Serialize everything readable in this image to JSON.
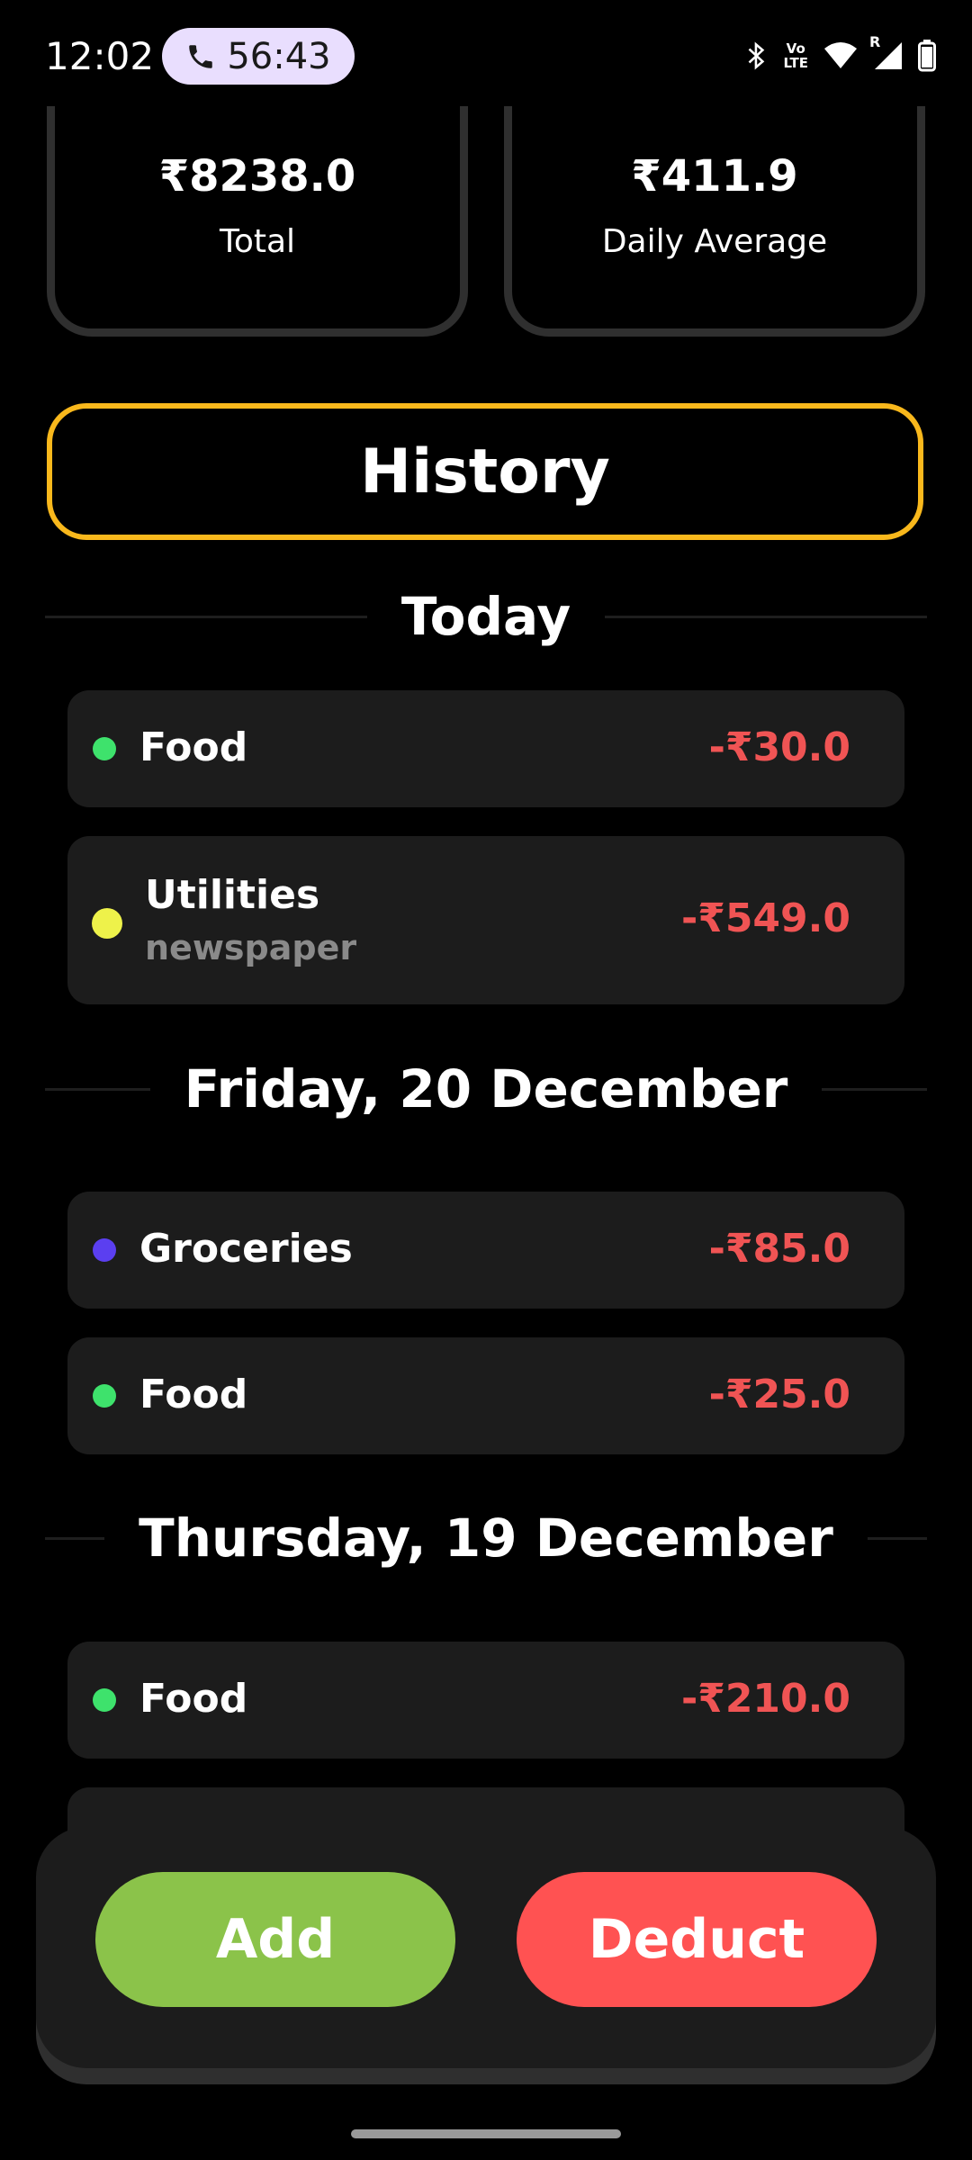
{
  "status_bar": {
    "time": "12:02",
    "call_timer": "56:43",
    "network_badge_top": "Vo",
    "network_badge_bottom": "LTE",
    "roaming": "R",
    "icons": [
      "bluetooth-icon",
      "volte-icon",
      "wifi-icon",
      "signal-icon",
      "battery-icon"
    ]
  },
  "summary": {
    "total_value": "₹8238.0",
    "total_label": "Total",
    "daily_value": "₹411.9",
    "daily_label": "Daily Average"
  },
  "history_label": "History",
  "groups": [
    {
      "date": "Today",
      "items": [
        {
          "category": "Food",
          "note": "",
          "amount": "-₹30.0",
          "dot_color": "#3ee26c"
        },
        {
          "category": "Utilities",
          "note": "newspaper",
          "amount": "-₹549.0",
          "dot_color": "#eef24a"
        }
      ]
    },
    {
      "date": "Friday, 20 December",
      "items": [
        {
          "category": "Groceries",
          "note": "",
          "amount": "-₹85.0",
          "dot_color": "#5b3ff0"
        },
        {
          "category": "Food",
          "note": "",
          "amount": "-₹25.0",
          "dot_color": "#3ee26c"
        }
      ]
    },
    {
      "date": "Thursday, 19 December",
      "items": [
        {
          "category": "Food",
          "note": "",
          "amount": "-₹210.0",
          "dot_color": "#3ee26c"
        }
      ]
    }
  ],
  "actions": {
    "add_label": "Add",
    "deduct_label": "Deduct"
  },
  "colors": {
    "accent_yellow": "#f9b81c",
    "expense_red": "#f05454",
    "add_green": "#8bc34a",
    "deduct_red": "#ff5252"
  }
}
